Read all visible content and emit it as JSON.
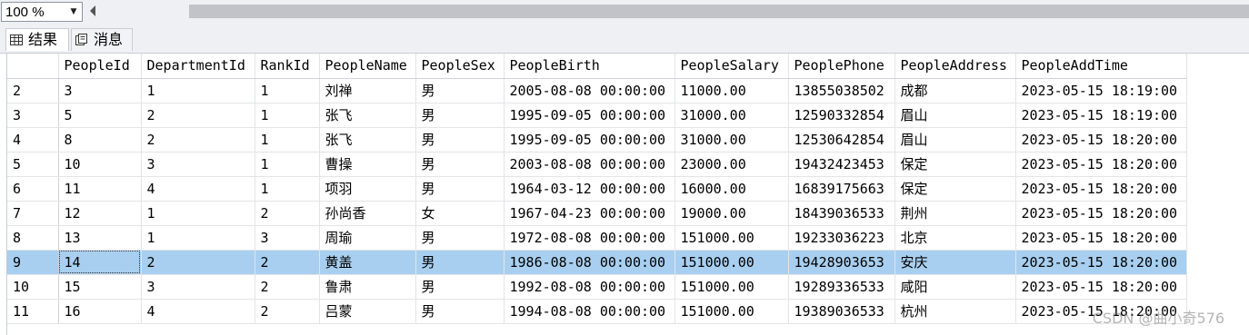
{
  "toolbar": {
    "zoom_value": "100 %",
    "zoom_caret": "▼"
  },
  "tabs": [
    {
      "label": "结果",
      "icon": "grid-icon",
      "active": true
    },
    {
      "label": "消息",
      "icon": "messages-icon",
      "active": false
    }
  ],
  "grid": {
    "columns": [
      "PeopleId",
      "DepartmentId",
      "RankId",
      "PeopleName",
      "PeopleSex",
      "PeopleBirth",
      "PeopleSalary",
      "PeoplePhone",
      "PeopleAddress",
      "PeopleAddTime"
    ],
    "rows": [
      {
        "num": "2",
        "cells": [
          "3",
          "1",
          "1",
          "刘禅",
          "男",
          "2005-08-08 00:00:00",
          "11000.00",
          "13855038502",
          "成都",
          "2023-05-15 18:19:00"
        ]
      },
      {
        "num": "3",
        "cells": [
          "5",
          "2",
          "1",
          "张飞",
          "男",
          "1995-09-05 00:00:00",
          "31000.00",
          "12590332854",
          "眉山",
          "2023-05-15 18:19:00"
        ]
      },
      {
        "num": "4",
        "cells": [
          "8",
          "2",
          "1",
          "张飞",
          "男",
          "1995-09-05 00:00:00",
          "31000.00",
          "12530642854",
          "眉山",
          "2023-05-15 18:20:00"
        ]
      },
      {
        "num": "5",
        "cells": [
          "10",
          "3",
          "1",
          "曹操",
          "男",
          "2003-08-08 00:00:00",
          "23000.00",
          "19432423453",
          "保定",
          "2023-05-15 18:20:00"
        ]
      },
      {
        "num": "6",
        "cells": [
          "11",
          "4",
          "1",
          "项羽",
          "男",
          "1964-03-12 00:00:00",
          "16000.00",
          "16839175663",
          "保定",
          "2023-05-15 18:20:00"
        ]
      },
      {
        "num": "7",
        "cells": [
          "12",
          "1",
          "2",
          "孙尚香",
          "女",
          "1967-04-23 00:00:00",
          "19000.00",
          "18439036533",
          "荆州",
          "2023-05-15 18:20:00"
        ]
      },
      {
        "num": "8",
        "cells": [
          "13",
          "1",
          "3",
          "周瑜",
          "男",
          "1972-08-08 00:00:00",
          "151000.00",
          "19233036223",
          "北京",
          "2023-05-15 18:20:00"
        ]
      },
      {
        "num": "9",
        "cells": [
          "14",
          "2",
          "2",
          "黄盖",
          "男",
          "1986-08-08 00:00:00",
          "151000.00",
          "19428903653",
          "安庆",
          "2023-05-15 18:20:00"
        ],
        "selected": true
      },
      {
        "num": "10",
        "cells": [
          "15",
          "3",
          "2",
          "鲁肃",
          "男",
          "1992-08-08 00:00:00",
          "151000.00",
          "19289336533",
          "咸阳",
          "2023-05-15 18:20:00"
        ]
      },
      {
        "num": "11",
        "cells": [
          "16",
          "4",
          "2",
          "吕蒙",
          "男",
          "1994-08-08 00:00:00",
          "151000.00",
          "19389036533",
          "杭州",
          "2023-05-15 18:20:00"
        ]
      }
    ]
  },
  "watermark": "CSDN @曲小奇576"
}
